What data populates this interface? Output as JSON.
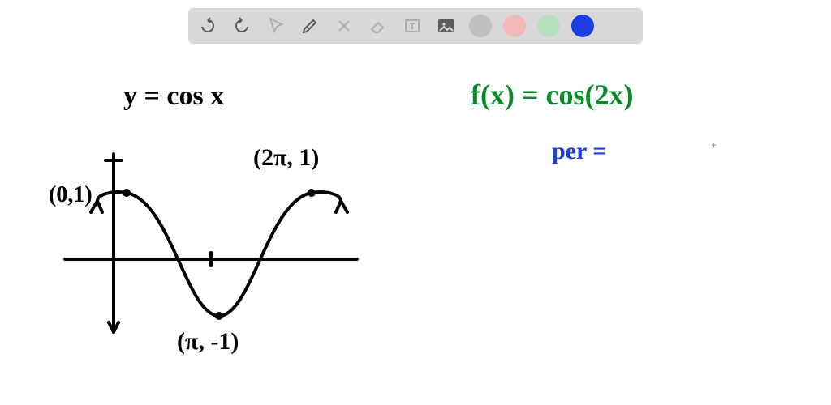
{
  "toolbar": {
    "tools": [
      {
        "name": "undo-icon"
      },
      {
        "name": "redo-icon"
      },
      {
        "name": "pointer-icon"
      },
      {
        "name": "pencil-icon"
      },
      {
        "name": "tools-icon"
      },
      {
        "name": "eraser-icon"
      },
      {
        "name": "text-box-icon"
      },
      {
        "name": "image-icon"
      }
    ],
    "swatches": [
      {
        "name": "swatch-gray",
        "color": "#bfbfbf"
      },
      {
        "name": "swatch-pink",
        "color": "#f2b8b8"
      },
      {
        "name": "swatch-green",
        "color": "#b6dfc0"
      },
      {
        "name": "swatch-blue",
        "color": "#1a3fe0"
      }
    ]
  },
  "annotations": {
    "eq_left": "y = cos x",
    "eq_right": "f(x) = cos(2x)",
    "per_label": "per =",
    "pt_origin": "(0,1)",
    "pt_pi": "(π, -1)",
    "pt_2pi": "(2π, 1)",
    "cursor": "+"
  },
  "chart_data": {
    "type": "line",
    "title": "",
    "xlabel": "",
    "ylabel": "",
    "ylim": [
      -1,
      1
    ],
    "x": [
      0,
      3.1416,
      6.2832
    ],
    "values": [
      1,
      -1,
      1
    ],
    "series_name": "y = cos x",
    "labeled_points": [
      {
        "label": "(0,1)",
        "x": 0,
        "y": 1
      },
      {
        "label": "(π,-1)",
        "x": 3.1416,
        "y": -1
      },
      {
        "label": "(2π,1)",
        "x": 6.2832,
        "y": 1
      }
    ]
  }
}
